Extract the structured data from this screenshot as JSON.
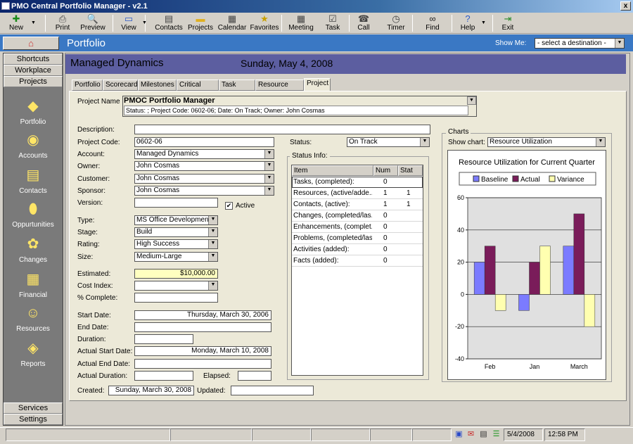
{
  "app": {
    "title": "PMO Central Portfolio Manager - v2.1",
    "close": "x"
  },
  "toolbar": [
    {
      "name": "new",
      "label": "New",
      "icon": "plus-icon",
      "glyph": "✚",
      "color": "#1a8a1a",
      "x": 6,
      "w": 34,
      "dd": true
    },
    {
      "name": "print",
      "label": "Print",
      "icon": "printer-icon",
      "glyph": "⎙",
      "color": "#444",
      "x": 76,
      "w": 26
    },
    {
      "name": "preview",
      "label": "Preview",
      "icon": "preview-icon",
      "glyph": "🔍",
      "color": "#444",
      "x": 110,
      "w": 44
    },
    {
      "name": "view",
      "label": "View",
      "icon": "view-icon",
      "glyph": "▭",
      "color": "#2a5ac8",
      "x": 168,
      "w": 30,
      "dd": true
    },
    {
      "name": "contacts",
      "label": "Contacts",
      "icon": "contacts-icon",
      "glyph": "▤",
      "color": "#444",
      "x": 218,
      "w": 44
    },
    {
      "name": "projects",
      "label": "Projects",
      "icon": "folder-icon",
      "glyph": "▬",
      "color": "#e0b020",
      "x": 264,
      "w": 42
    },
    {
      "name": "calendar",
      "label": "Calendar",
      "icon": "calendar-icon",
      "glyph": "▦",
      "color": "#444",
      "x": 309,
      "w": 42
    },
    {
      "name": "favorites",
      "label": "Favorites",
      "icon": "favorites-icon",
      "glyph": "★",
      "color": "#c8a000",
      "x": 354,
      "w": 44
    },
    {
      "name": "meeting",
      "label": "Meeting",
      "icon": "meeting-icon",
      "glyph": "▦",
      "color": "#444",
      "x": 408,
      "w": 40
    },
    {
      "name": "task",
      "label": "Task",
      "icon": "task-icon",
      "glyph": "☑",
      "color": "#444",
      "x": 458,
      "w": 30
    },
    {
      "name": "call",
      "label": "Call",
      "icon": "phone-icon",
      "glyph": "☎",
      "color": "#444",
      "x": 503,
      "w": 28
    },
    {
      "name": "timer",
      "label": "Timer",
      "icon": "timer-icon",
      "glyph": "◷",
      "color": "#444",
      "x": 548,
      "w": 30
    },
    {
      "name": "find",
      "label": "Find",
      "icon": "binoculars-icon",
      "glyph": "∞",
      "color": "#222",
      "x": 600,
      "w": 30
    },
    {
      "name": "help",
      "label": "Help",
      "icon": "help-icon",
      "glyph": "?",
      "color": "#2a5ac8",
      "x": 650,
      "w": 30,
      "dd": true
    },
    {
      "name": "exit",
      "label": "Exit",
      "icon": "exit-icon",
      "glyph": "⇥",
      "color": "#2a8a2a",
      "x": 708,
      "w": 28
    }
  ],
  "bluebar": {
    "title": "Portfolio",
    "show_me_label": "Show Me:",
    "destination": "- select a destination -"
  },
  "nav": {
    "tabs_top": [
      "Shortcuts",
      "Workplace",
      "Projects"
    ],
    "items": [
      {
        "label": "Portfolio",
        "icon": "portfolio-icon",
        "glyph": "◆"
      },
      {
        "label": "Accounts",
        "icon": "accounts-icon",
        "glyph": "◉"
      },
      {
        "label": "Contacts",
        "icon": "contacts-card-icon",
        "glyph": "▤"
      },
      {
        "label": "Oppurtunities",
        "icon": "opportunities-icon",
        "glyph": "⬮"
      },
      {
        "label": "Changes",
        "icon": "changes-icon",
        "glyph": "✿"
      },
      {
        "label": "Financial",
        "icon": "financial-icon",
        "glyph": "▦"
      },
      {
        "label": "Resources",
        "icon": "resources-icon",
        "glyph": "☺"
      },
      {
        "label": "Reports",
        "icon": "reports-icon",
        "glyph": "◈"
      }
    ],
    "tabs_bottom": [
      "Services",
      "Settings"
    ]
  },
  "header": {
    "company": "Managed Dynamics",
    "date": "Sunday, May 4, 2008"
  },
  "tabs": [
    "Portfolio",
    "Scorecard",
    "Milestones",
    "Critical Path",
    "Task View",
    "Resource View",
    "Project"
  ],
  "project": {
    "name_label": "Project Name",
    "name": "PMOC Portfolio Manager",
    "status_line": "Status: ; Project Code: 0602-06; Date: On Track; Owner: John Cosmas",
    "labels": {
      "description": "Description:",
      "code": "Project Code:",
      "account": "Account:",
      "owner": "Owner:",
      "customer": "Customer:",
      "sponsor": "Sponsor:",
      "version": "Version:",
      "active": "Active",
      "type": "Type:",
      "stage": "Stage:",
      "rating": "Rating:",
      "size": "Size:",
      "estimated": "Estimated:",
      "cost_index": "Cost Index:",
      "complete": "% Complete:",
      "start_date": "Start Date:",
      "end_date": "End Date:",
      "duration": "Duration:",
      "actual_start": "Actual Start Date:",
      "actual_end": "Actual End Date:",
      "actual_duration": "Actual Duration:",
      "elapsed": "Elapsed:",
      "created": "Created:",
      "updated": "Updated:",
      "status": "Status:"
    },
    "values": {
      "description": "",
      "code": "0602-06",
      "account": "Managed Dynamics",
      "owner": "John Cosmas",
      "customer": "John Cosmas",
      "sponsor": "John Cosmas",
      "version": "",
      "active": true,
      "type": "MS Office Development",
      "stage": "Build",
      "rating": "High Success",
      "size": "Medium-Large",
      "estimated": "$10,000.00",
      "cost_index": "",
      "complete": "",
      "start_date": "Thursday, March 30, 2006",
      "end_date": "",
      "duration": "",
      "actual_start": "Monday, March 10, 2008",
      "actual_end": "",
      "actual_duration": "",
      "elapsed": "",
      "created": "Sunday, March 30, 2008",
      "updated": "",
      "status": "On Track"
    }
  },
  "status_info": {
    "title": "Status Info:",
    "columns": [
      "Item",
      "Num",
      "Stat"
    ],
    "rows": [
      {
        "item": "Tasks, (completed):",
        "num": "0",
        "stat": ""
      },
      {
        "item": "Resources, (active/adde...",
        "num": "1",
        "stat": "1"
      },
      {
        "item": "Contacts, (active):",
        "num": "1",
        "stat": "1"
      },
      {
        "item": "Changes, (completed/las...",
        "num": "0",
        "stat": ""
      },
      {
        "item": "Enhancements, (complet...",
        "num": "0",
        "stat": ""
      },
      {
        "item": "Problems, (completed/las...",
        "num": "0",
        "stat": ""
      },
      {
        "item": "Activities (added):",
        "num": "0",
        "stat": ""
      },
      {
        "item": "Facts (added):",
        "num": "0",
        "stat": ""
      }
    ]
  },
  "charts": {
    "group_title": "Charts",
    "show_label": "Show chart:",
    "selected": "Resource Utilization"
  },
  "chart_data": {
    "type": "bar",
    "title": "Resource Utilization for Current Quarter",
    "categories": [
      "Feb",
      "Jan",
      "March"
    ],
    "series": [
      {
        "name": "Baseline",
        "values": [
          20,
          -10,
          30
        ],
        "color": "#7b7bff"
      },
      {
        "name": "Actual",
        "values": [
          30,
          20,
          50
        ],
        "color": "#7a1c5a"
      },
      {
        "name": "Variance",
        "values": [
          -10,
          30,
          -20
        ],
        "color": "#ffffb0"
      }
    ],
    "ylim": [
      -40,
      60
    ],
    "yticks": [
      "60",
      "40",
      "20",
      "0",
      "-20",
      "-40"
    ],
    "grid": true,
    "legend": "top"
  },
  "statusbar": {
    "date": "5/4/2008",
    "time": "12:58 PM"
  },
  "colors": {
    "bluebar": "#3a78c4",
    "header": "#5c5ea0",
    "estimated": "#ffffc0"
  }
}
